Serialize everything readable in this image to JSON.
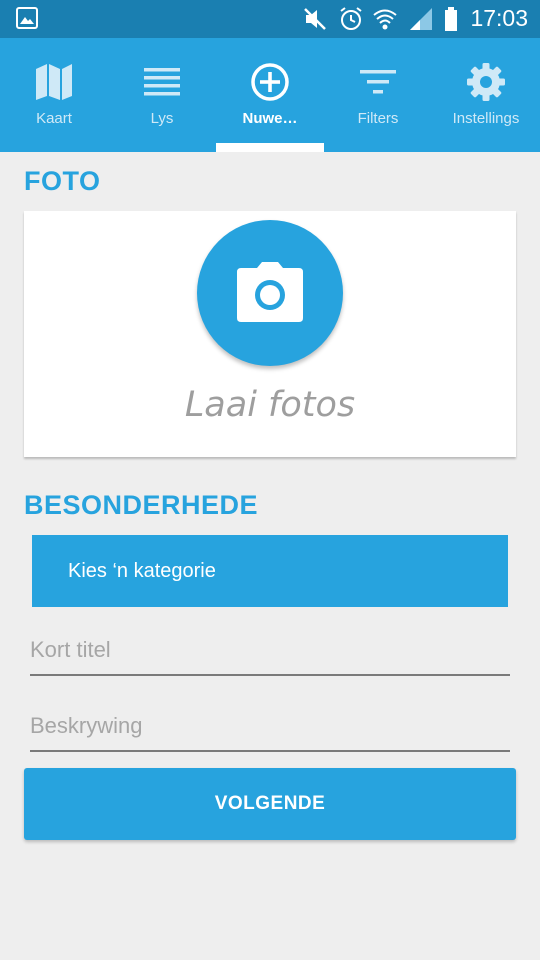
{
  "status_bar": {
    "time": "17:03",
    "icons": [
      "gallery-notification-icon",
      "mute-icon",
      "alarm-icon",
      "wifi-icon",
      "signal-icon",
      "battery-icon"
    ]
  },
  "tabs": [
    {
      "label": "Kaart",
      "icon": "map-icon",
      "active": false
    },
    {
      "label": "Lys",
      "icon": "list-icon",
      "active": false
    },
    {
      "label": "Nuwe…",
      "icon": "add-circle-icon",
      "active": true
    },
    {
      "label": "Filters",
      "icon": "filter-icon",
      "active": false
    },
    {
      "label": "Instellings",
      "icon": "gear-icon",
      "active": false
    }
  ],
  "photo_section": {
    "heading": "FOTO",
    "upload_label": "Laai fotos",
    "icon": "camera-icon"
  },
  "details_section": {
    "heading": "BESONDERHEDE",
    "category_label": "Kies ‘n kategorie",
    "title_placeholder": "Kort titel",
    "description_placeholder": "Beskrywing",
    "title_value": "",
    "description_value": ""
  },
  "next_button": {
    "label": "VOLGENDE"
  },
  "colors": {
    "accent": "#27a3de",
    "status_bar": "#1a7fb1",
    "background": "#eeeeee"
  }
}
